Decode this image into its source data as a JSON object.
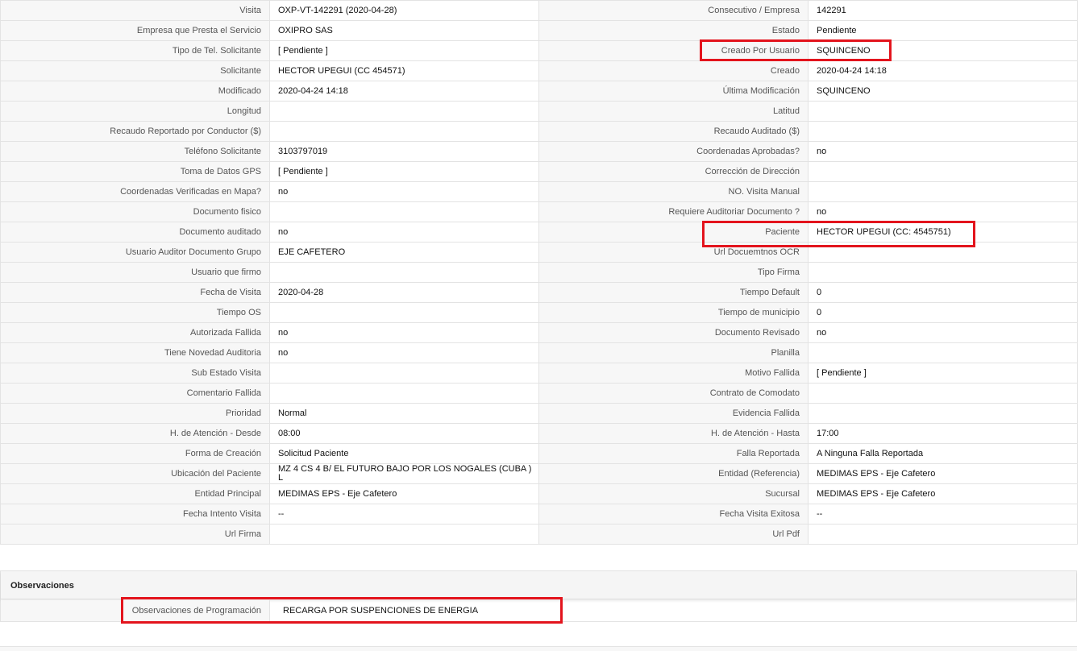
{
  "rows": [
    {
      "l1": "Visita",
      "v1": "OXP-VT-142291 (2020-04-28)",
      "l2": "Consecutivo / Empresa",
      "v2": "142291"
    },
    {
      "l1": "Empresa que Presta el Servicio",
      "v1": "OXIPRO SAS",
      "l2": "Estado",
      "v2": "Pendiente"
    },
    {
      "l1": "Tipo de Tel. Solicitante",
      "v1": "[ Pendiente ]",
      "l2": "Creado Por Usuario",
      "v2": "SQUINCENO"
    },
    {
      "l1": "Solicitante",
      "v1": "HECTOR UPEGUI (CC 454571)",
      "l2": "Creado",
      "v2": "2020-04-24 14:18"
    },
    {
      "l1": "Modificado",
      "v1": "2020-04-24 14:18",
      "l2": "Última Modificación",
      "v2": "SQUINCENO"
    },
    {
      "l1": "Longitud",
      "v1": "",
      "l2": "Latitud",
      "v2": ""
    },
    {
      "l1": "Recaudo Reportado por Conductor ($)",
      "v1": "",
      "l2": "Recaudo Auditado ($)",
      "v2": ""
    },
    {
      "l1": "Teléfono Solicitante",
      "v1": "3103797019",
      "l2": "Coordenadas Aprobadas?",
      "v2": "no"
    },
    {
      "l1": "Toma de Datos GPS",
      "v1": "[ Pendiente ]",
      "l2": "Corrección de Dirección",
      "v2": ""
    },
    {
      "l1": "Coordenadas Verificadas en Mapa?",
      "v1": "no",
      "l2": "NO. Visita Manual",
      "v2": ""
    },
    {
      "l1": "Documento fisico",
      "v1": "",
      "l2": "Requiere Auditoriar Documento ?",
      "v2": "no"
    },
    {
      "l1": "Documento auditado",
      "v1": "no",
      "l2": "Paciente",
      "v2": "HECTOR UPEGUI (CC: 4545751)"
    },
    {
      "l1": "Usuario Auditor Documento Grupo",
      "v1": "EJE CAFETERO",
      "l2": "Url Docuemtnos OCR",
      "v2": ""
    },
    {
      "l1": "Usuario que firmo",
      "v1": "",
      "l2": "Tipo Firma",
      "v2": ""
    },
    {
      "l1": "Fecha de Visita",
      "v1": "2020-04-28",
      "l2": "Tiempo Default",
      "v2": "0"
    },
    {
      "l1": "Tiempo OS",
      "v1": "",
      "l2": "Tiempo de municipio",
      "v2": "0"
    },
    {
      "l1": "Autorizada Fallida",
      "v1": "no",
      "l2": "Documento Revisado",
      "v2": "no"
    },
    {
      "l1": "Tiene Novedad Auditoria",
      "v1": "no",
      "l2": "Planilla",
      "v2": ""
    },
    {
      "l1": "Sub Estado Visita",
      "v1": "",
      "l2": "Motivo Fallida",
      "v2": "[ Pendiente ]"
    },
    {
      "l1": "Comentario Fallida",
      "v1": "",
      "l2": "Contrato de Comodato",
      "v2": ""
    },
    {
      "l1": "Prioridad",
      "v1": "Normal",
      "l2": "Evidencia Fallida",
      "v2": ""
    },
    {
      "l1": "H. de Atención - Desde",
      "v1": "08:00",
      "l2": "H. de Atención - Hasta",
      "v2": "17:00"
    },
    {
      "l1": "Forma de Creación",
      "v1": "Solicitud Paciente",
      "l2": "Falla Reportada",
      "v2": "A Ninguna Falla Reportada"
    },
    {
      "l1": "Ubicación del Paciente",
      "v1": "MZ 4 CS 4 B/ EL FUTURO BAJO POR LOS NOGALES (CUBA ) L",
      "l2": "Entidad (Referencia)",
      "v2": "MEDIMAS EPS - Eje Cafetero"
    },
    {
      "l1": "Entidad Principal",
      "v1": "MEDIMAS EPS - Eje Cafetero",
      "l2": "Sucursal",
      "v2": "MEDIMAS EPS - Eje Cafetero"
    },
    {
      "l1": "Fecha Intento Visita",
      "v1": "--",
      "l2": "Fecha Visita Exitosa",
      "v2": "--"
    },
    {
      "l1": "Url Firma",
      "v1": "",
      "l2": "Url Pdf",
      "v2": ""
    }
  ],
  "observaciones": {
    "title": "Observaciones",
    "label": "Observaciones de Programación",
    "value": "RECARGA POR SUSPENCIONES DE ENERGIA"
  },
  "highlight_color": "#e3141d"
}
